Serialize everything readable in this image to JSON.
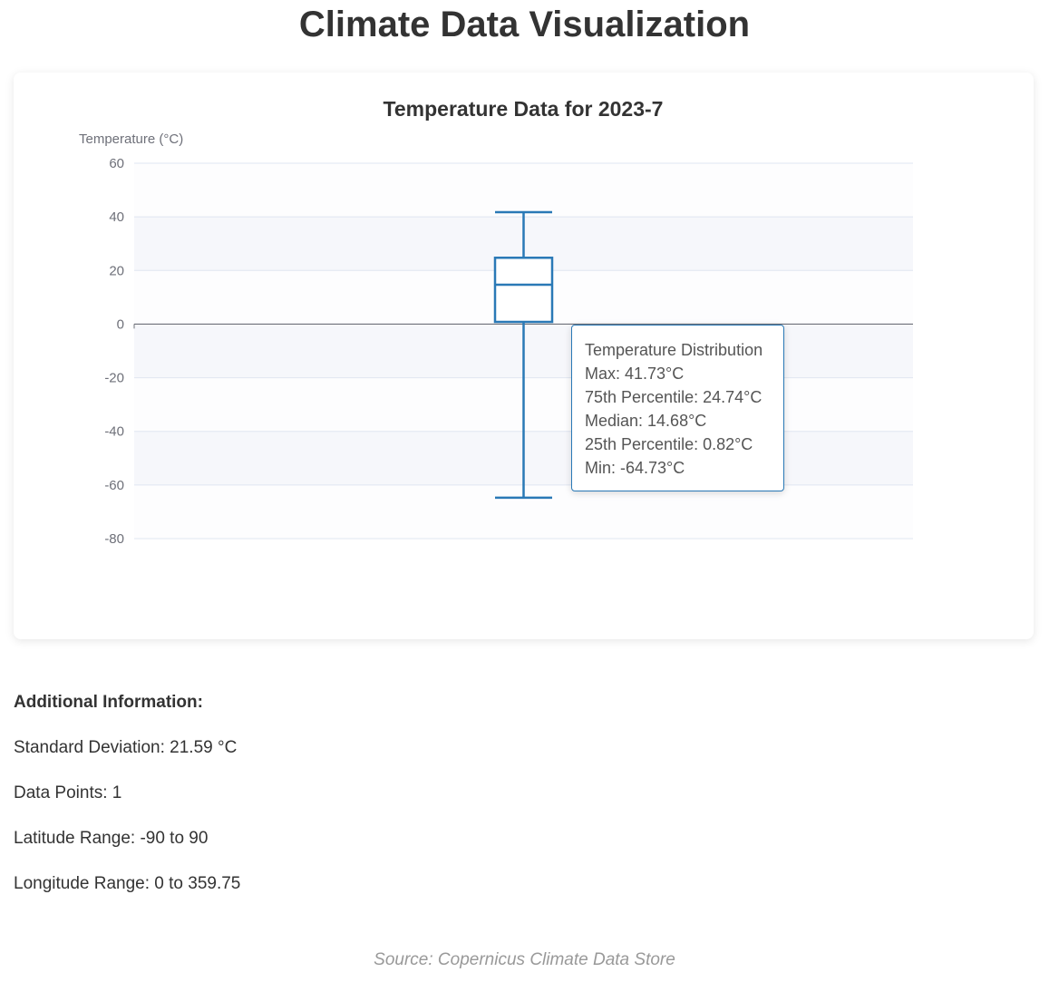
{
  "page": {
    "title": "Climate Data Visualization",
    "source": "Source: Copernicus Climate Data Store"
  },
  "additional_info": {
    "heading": "Additional Information:",
    "lines": [
      "Standard Deviation: 21.59 °C",
      "Data Points: 1",
      "Latitude Range: -90 to 90",
      "Longitude Range: 0 to 359.75"
    ]
  },
  "tooltip": {
    "title": "Temperature Distribution",
    "lines": [
      "Max: 41.73°C",
      "75th Percentile: 24.74°C",
      "Median: 14.68°C",
      "25th Percentile: 0.82°C",
      "Min: -64.73°C"
    ]
  },
  "colors": {
    "box_stroke": "#2a79b6",
    "grid": "#e0e6f1",
    "band": "#f6f7fb",
    "axis_label": "#6e7079",
    "zero_line": "#6e7079"
  },
  "chart_data": {
    "type": "boxplot",
    "title": "Temperature Data for 2023-7",
    "xlabel": "",
    "ylabel": "Temperature (°C)",
    "ylim": [
      -80,
      60
    ],
    "y_ticks": [
      60,
      40,
      20,
      0,
      -20,
      -40,
      -60,
      -80
    ],
    "y_tick_labels": [
      "60",
      "40",
      "20",
      "0",
      "-20",
      "-40",
      "-60",
      "-80"
    ],
    "grid": true,
    "split_area": true,
    "box": {
      "min": -64.73,
      "q1": 0.82,
      "median": 14.68,
      "q3": 24.74,
      "max": 41.73
    }
  }
}
